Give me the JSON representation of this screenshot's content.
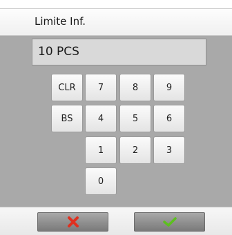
{
  "header": {
    "title": "Limite Inf."
  },
  "display": {
    "value": "10 PCS"
  },
  "keypad": {
    "clr": "CLR",
    "bs": "BS",
    "k7": "7",
    "k8": "8",
    "k9": "9",
    "k4": "4",
    "k5": "5",
    "k6": "6",
    "k1": "1",
    "k2": "2",
    "k3": "3",
    "k0": "0"
  },
  "footer": {
    "cancel_icon": "x-icon",
    "cancel_color": "#e0301f",
    "confirm_icon": "check-icon",
    "confirm_color": "#5cc01e"
  }
}
